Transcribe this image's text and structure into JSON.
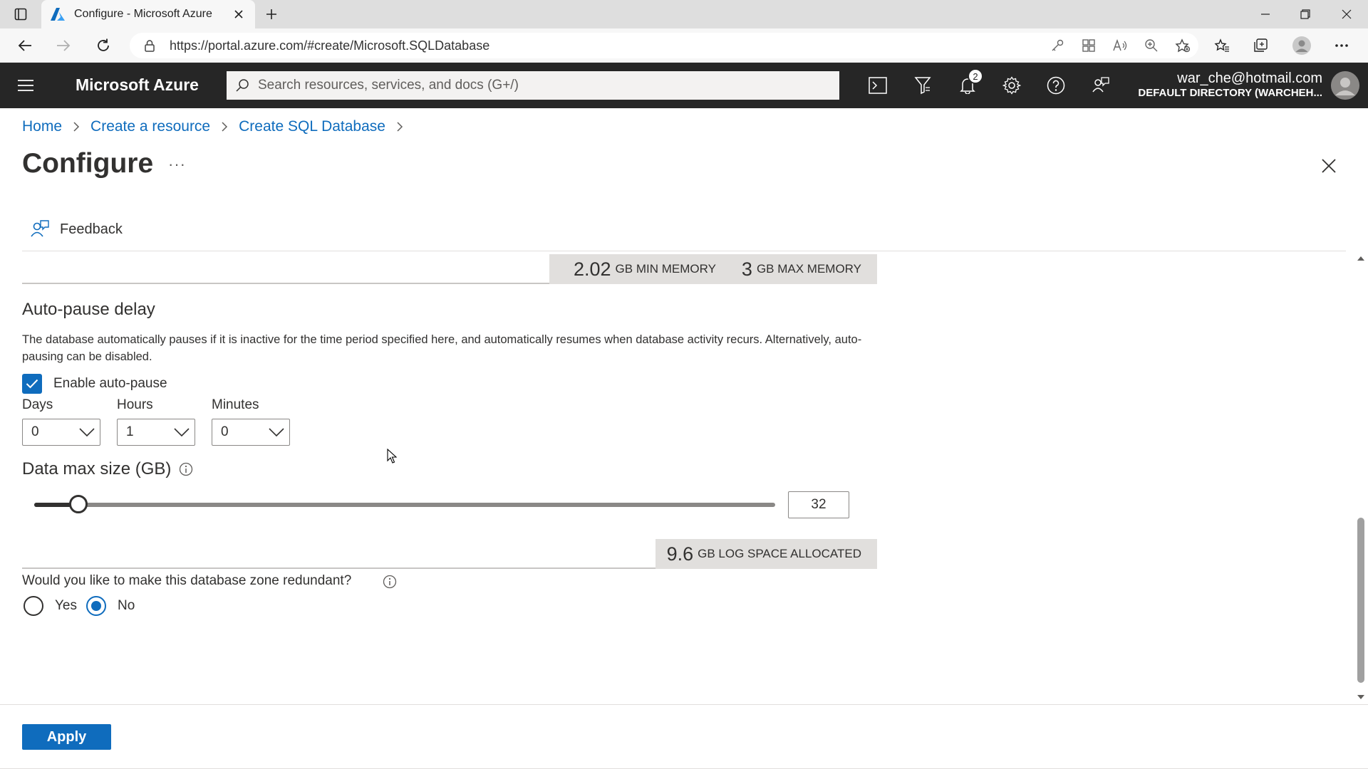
{
  "browser": {
    "tab_title": "Configure - Microsoft Azure",
    "url": "https://portal.azure.com/#create/Microsoft.SQLDatabase"
  },
  "azure_header": {
    "brand": "Microsoft Azure",
    "search_placeholder": "Search resources, services, and docs (G+/)",
    "notification_count": "2",
    "account_name": "war_che@hotmail.com",
    "account_directory": "DEFAULT DIRECTORY (WARCHEH..."
  },
  "breadcrumb": {
    "items": [
      "Home",
      "Create a resource",
      "Create SQL Database"
    ]
  },
  "page": {
    "title": "Configure",
    "more": "···"
  },
  "feedback_label": "Feedback",
  "memory": {
    "min_value": "2.02",
    "min_unit": "GB MIN MEMORY",
    "max_value": "3",
    "max_unit": "GB MAX MEMORY"
  },
  "auto_pause": {
    "title": "Auto-pause delay",
    "description": "The database automatically pauses if it is inactive for the time period specified here, and automatically resumes when database activity recurs. Alternatively, auto-pausing can be disabled.",
    "enable_label": "Enable auto-pause",
    "enabled": true,
    "days_label": "Days",
    "days_value": "0",
    "hours_label": "Hours",
    "hours_value": "1",
    "minutes_label": "Minutes",
    "minutes_value": "0"
  },
  "data_max_size": {
    "title": "Data max size (GB)",
    "value": "32",
    "slider_fraction": 0.06
  },
  "log_space": {
    "value": "9.6",
    "unit": "GB LOG SPACE ALLOCATED"
  },
  "zone_redundant": {
    "question": "Would you like to make this database zone redundant?",
    "yes_label": "Yes",
    "no_label": "No",
    "selected": "No"
  },
  "footer": {
    "apply_label": "Apply"
  },
  "colors": {
    "accent": "#0f6cbd",
    "header_bg": "#262626"
  }
}
